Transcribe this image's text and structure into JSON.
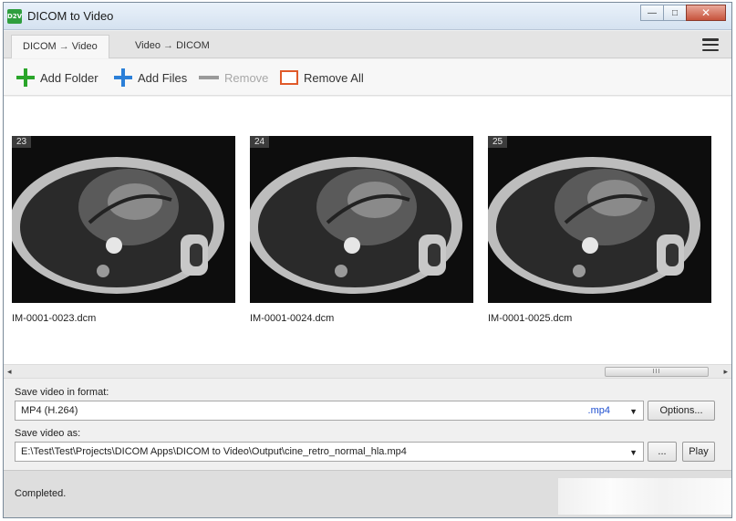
{
  "window": {
    "app_icon_text": "D2V",
    "title": "DICOM to Video"
  },
  "tabs": [
    {
      "from": "DICOM",
      "arrow": "→",
      "to": "Video"
    },
    {
      "from": "Video",
      "arrow": "→",
      "to": "DICOM"
    }
  ],
  "toolbar": {
    "add_folder": "Add Folder",
    "add_files": "Add Files",
    "remove": "Remove",
    "remove_all": "Remove All"
  },
  "thumbnails": [
    {
      "number": "23",
      "filename": "IM-0001-0023.dcm"
    },
    {
      "number": "24",
      "filename": "IM-0001-0024.dcm"
    },
    {
      "number": "25",
      "filename": "IM-0001-0025.dcm"
    }
  ],
  "scrollbar": {
    "left_arrow": "◂",
    "right_arrow": "▸",
    "grip": "III"
  },
  "settings": {
    "format_label": "Save video in format:",
    "format_value": "MP4 (H.264)",
    "format_ext": ".mp4",
    "options_button": "Options...",
    "save_as_label": "Save video as:",
    "save_as_value": "E:\\Test\\Test\\Projects\\DICOM Apps\\DICOM to Video\\Output\\cine_retro_normal_hla.mp4",
    "browse_button": "...",
    "play_button": "Play",
    "dropdown_glyph": "▼"
  },
  "status": {
    "text": "Completed."
  },
  "colors": {
    "add_folder_icon": "#2aa52a",
    "add_files_icon": "#2b7fd8",
    "remove_all_icon": "#e05a2a",
    "format_ext": "#1f4fd0"
  }
}
